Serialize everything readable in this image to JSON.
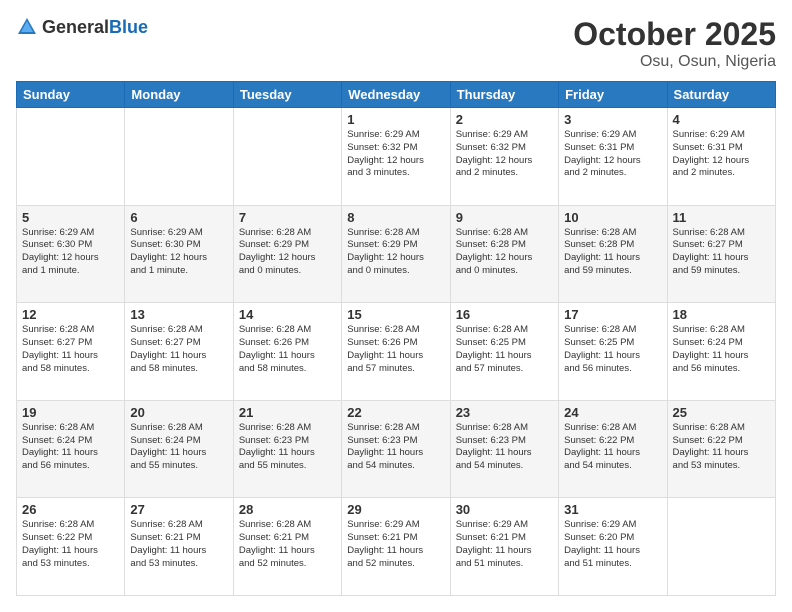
{
  "header": {
    "logo": {
      "text_general": "General",
      "text_blue": "Blue"
    },
    "title": "October 2025",
    "location": "Osu, Osun, Nigeria"
  },
  "weekdays": [
    "Sunday",
    "Monday",
    "Tuesday",
    "Wednesday",
    "Thursday",
    "Friday",
    "Saturday"
  ],
  "rows": [
    {
      "alt": false,
      "cells": [
        {
          "empty": true
        },
        {
          "empty": true
        },
        {
          "empty": true
        },
        {
          "day": "1",
          "lines": [
            "Sunrise: 6:29 AM",
            "Sunset: 6:32 PM",
            "Daylight: 12 hours",
            "and 3 minutes."
          ]
        },
        {
          "day": "2",
          "lines": [
            "Sunrise: 6:29 AM",
            "Sunset: 6:32 PM",
            "Daylight: 12 hours",
            "and 2 minutes."
          ]
        },
        {
          "day": "3",
          "lines": [
            "Sunrise: 6:29 AM",
            "Sunset: 6:31 PM",
            "Daylight: 12 hours",
            "and 2 minutes."
          ]
        },
        {
          "day": "4",
          "lines": [
            "Sunrise: 6:29 AM",
            "Sunset: 6:31 PM",
            "Daylight: 12 hours",
            "and 2 minutes."
          ]
        }
      ]
    },
    {
      "alt": true,
      "cells": [
        {
          "day": "5",
          "lines": [
            "Sunrise: 6:29 AM",
            "Sunset: 6:30 PM",
            "Daylight: 12 hours",
            "and 1 minute."
          ]
        },
        {
          "day": "6",
          "lines": [
            "Sunrise: 6:29 AM",
            "Sunset: 6:30 PM",
            "Daylight: 12 hours",
            "and 1 minute."
          ]
        },
        {
          "day": "7",
          "lines": [
            "Sunrise: 6:28 AM",
            "Sunset: 6:29 PM",
            "Daylight: 12 hours",
            "and 0 minutes."
          ]
        },
        {
          "day": "8",
          "lines": [
            "Sunrise: 6:28 AM",
            "Sunset: 6:29 PM",
            "Daylight: 12 hours",
            "and 0 minutes."
          ]
        },
        {
          "day": "9",
          "lines": [
            "Sunrise: 6:28 AM",
            "Sunset: 6:28 PM",
            "Daylight: 12 hours",
            "and 0 minutes."
          ]
        },
        {
          "day": "10",
          "lines": [
            "Sunrise: 6:28 AM",
            "Sunset: 6:28 PM",
            "Daylight: 11 hours",
            "and 59 minutes."
          ]
        },
        {
          "day": "11",
          "lines": [
            "Sunrise: 6:28 AM",
            "Sunset: 6:27 PM",
            "Daylight: 11 hours",
            "and 59 minutes."
          ]
        }
      ]
    },
    {
      "alt": false,
      "cells": [
        {
          "day": "12",
          "lines": [
            "Sunrise: 6:28 AM",
            "Sunset: 6:27 PM",
            "Daylight: 11 hours",
            "and 58 minutes."
          ]
        },
        {
          "day": "13",
          "lines": [
            "Sunrise: 6:28 AM",
            "Sunset: 6:27 PM",
            "Daylight: 11 hours",
            "and 58 minutes."
          ]
        },
        {
          "day": "14",
          "lines": [
            "Sunrise: 6:28 AM",
            "Sunset: 6:26 PM",
            "Daylight: 11 hours",
            "and 58 minutes."
          ]
        },
        {
          "day": "15",
          "lines": [
            "Sunrise: 6:28 AM",
            "Sunset: 6:26 PM",
            "Daylight: 11 hours",
            "and 57 minutes."
          ]
        },
        {
          "day": "16",
          "lines": [
            "Sunrise: 6:28 AM",
            "Sunset: 6:25 PM",
            "Daylight: 11 hours",
            "and 57 minutes."
          ]
        },
        {
          "day": "17",
          "lines": [
            "Sunrise: 6:28 AM",
            "Sunset: 6:25 PM",
            "Daylight: 11 hours",
            "and 56 minutes."
          ]
        },
        {
          "day": "18",
          "lines": [
            "Sunrise: 6:28 AM",
            "Sunset: 6:24 PM",
            "Daylight: 11 hours",
            "and 56 minutes."
          ]
        }
      ]
    },
    {
      "alt": true,
      "cells": [
        {
          "day": "19",
          "lines": [
            "Sunrise: 6:28 AM",
            "Sunset: 6:24 PM",
            "Daylight: 11 hours",
            "and 56 minutes."
          ]
        },
        {
          "day": "20",
          "lines": [
            "Sunrise: 6:28 AM",
            "Sunset: 6:24 PM",
            "Daylight: 11 hours",
            "and 55 minutes."
          ]
        },
        {
          "day": "21",
          "lines": [
            "Sunrise: 6:28 AM",
            "Sunset: 6:23 PM",
            "Daylight: 11 hours",
            "and 55 minutes."
          ]
        },
        {
          "day": "22",
          "lines": [
            "Sunrise: 6:28 AM",
            "Sunset: 6:23 PM",
            "Daylight: 11 hours",
            "and 54 minutes."
          ]
        },
        {
          "day": "23",
          "lines": [
            "Sunrise: 6:28 AM",
            "Sunset: 6:23 PM",
            "Daylight: 11 hours",
            "and 54 minutes."
          ]
        },
        {
          "day": "24",
          "lines": [
            "Sunrise: 6:28 AM",
            "Sunset: 6:22 PM",
            "Daylight: 11 hours",
            "and 54 minutes."
          ]
        },
        {
          "day": "25",
          "lines": [
            "Sunrise: 6:28 AM",
            "Sunset: 6:22 PM",
            "Daylight: 11 hours",
            "and 53 minutes."
          ]
        }
      ]
    },
    {
      "alt": false,
      "cells": [
        {
          "day": "26",
          "lines": [
            "Sunrise: 6:28 AM",
            "Sunset: 6:22 PM",
            "Daylight: 11 hours",
            "and 53 minutes."
          ]
        },
        {
          "day": "27",
          "lines": [
            "Sunrise: 6:28 AM",
            "Sunset: 6:21 PM",
            "Daylight: 11 hours",
            "and 53 minutes."
          ]
        },
        {
          "day": "28",
          "lines": [
            "Sunrise: 6:28 AM",
            "Sunset: 6:21 PM",
            "Daylight: 11 hours",
            "and 52 minutes."
          ]
        },
        {
          "day": "29",
          "lines": [
            "Sunrise: 6:29 AM",
            "Sunset: 6:21 PM",
            "Daylight: 11 hours",
            "and 52 minutes."
          ]
        },
        {
          "day": "30",
          "lines": [
            "Sunrise: 6:29 AM",
            "Sunset: 6:21 PM",
            "Daylight: 11 hours",
            "and 51 minutes."
          ]
        },
        {
          "day": "31",
          "lines": [
            "Sunrise: 6:29 AM",
            "Sunset: 6:20 PM",
            "Daylight: 11 hours",
            "and 51 minutes."
          ]
        },
        {
          "empty": true
        }
      ]
    }
  ]
}
